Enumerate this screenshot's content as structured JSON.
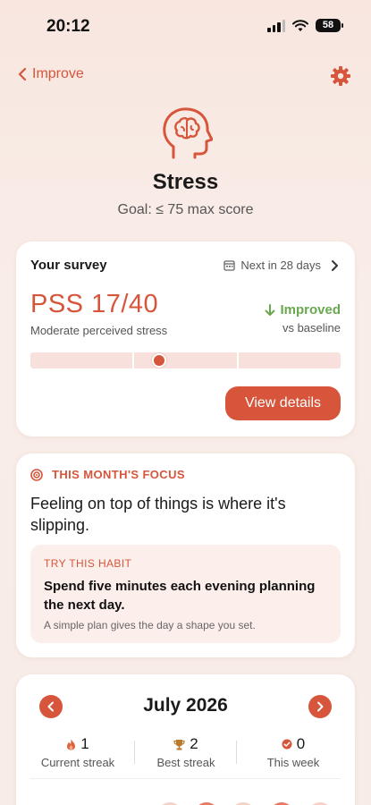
{
  "status_bar": {
    "time": "20:12",
    "battery": "58"
  },
  "nav": {
    "back_label": "Improve"
  },
  "hero": {
    "title": "Stress",
    "goal": "Goal: ≤ 75 max score"
  },
  "survey": {
    "title": "Your survey",
    "next_in": "Next in 28 days",
    "score": "PSS 17/40",
    "score_desc": "Moderate perceived stress",
    "trend": "Improved",
    "trend_sub": "vs baseline",
    "score_fraction": 0.425,
    "button": "View details"
  },
  "focus": {
    "heading": "THIS MONTH'S FOCUS",
    "text": "Feeling on top of things is where it's slipping.",
    "habit_label": "TRY THIS HABIT",
    "habit_title": "Spend five minutes each evening planning the next day.",
    "habit_sub": "A simple plan gives the day a shape you set."
  },
  "calendar": {
    "month": "July 2026",
    "streaks": [
      {
        "icon": "flame-icon",
        "value": "1",
        "label": "Current streak"
      },
      {
        "icon": "trophy-icon",
        "value": "2",
        "label": "Best streak"
      },
      {
        "icon": "check-circle-icon",
        "value": "0",
        "label": "This week"
      }
    ]
  },
  "colors": {
    "accent": "#d6553b",
    "positive": "#6aa84f",
    "habit_bg": "#fcefeb"
  }
}
